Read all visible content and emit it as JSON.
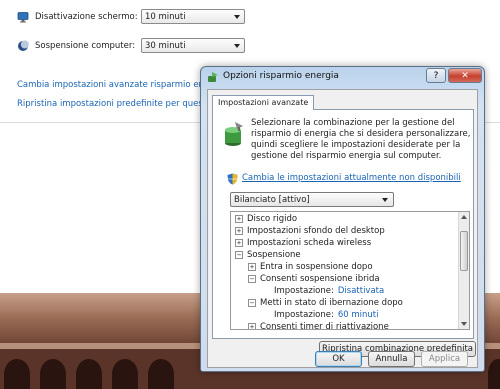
{
  "background": {
    "rows": [
      {
        "label": "Disattivazione schermo:",
        "value": "10 minuti",
        "icon": "monitor-icon"
      },
      {
        "label": "Sospensione computer:",
        "value": "30 minuti",
        "icon": "moon-icon"
      }
    ],
    "links": [
      "Cambia impostazioni avanzate risparmio energia",
      "Ripristina impostazioni predefinite per questa combinazione"
    ]
  },
  "dialog": {
    "title": "Opzioni risparmio energia",
    "help_label": "?",
    "close_label": "✕",
    "tab_label": "Impostazioni avanzate",
    "description": "Selezionare la combinazione per la gestione del risparmio di energia che si desidera personalizzare, quindi scegliere le impostazioni desiderate per la gestione del risparmio energia sul computer.",
    "change_link": "Cambia le impostazioni attualmente non disponibili",
    "plan_selected": "Bilanciato [attivo]",
    "tree": [
      {
        "expander": "+",
        "label": "Disco rigido"
      },
      {
        "expander": "+",
        "label": "Impostazioni sfondo del desktop"
      },
      {
        "expander": "+",
        "label": "Impostazioni scheda wireless"
      },
      {
        "expander": "−",
        "label": "Sospensione"
      },
      {
        "expander": "+",
        "label": "Entra in sospensione dopo"
      },
      {
        "expander": "−",
        "label": "Consenti sospensione ibrida"
      },
      {
        "label": "Impostazione:",
        "value": "Disattivata"
      },
      {
        "expander": "−",
        "label": "Metti in stato di ibernazione dopo"
      },
      {
        "label": "Impostazione:",
        "value": "60 minuti"
      },
      {
        "expander": "+",
        "label": "Consenti timer di riattivazione"
      }
    ],
    "restore_label": "Ripristina combinazione predefinita",
    "ok_label": "OK",
    "cancel_label": "Annulla",
    "apply_label": "Applica"
  },
  "colors": {
    "link": "#1a64b4",
    "value": "#1a64b4"
  }
}
